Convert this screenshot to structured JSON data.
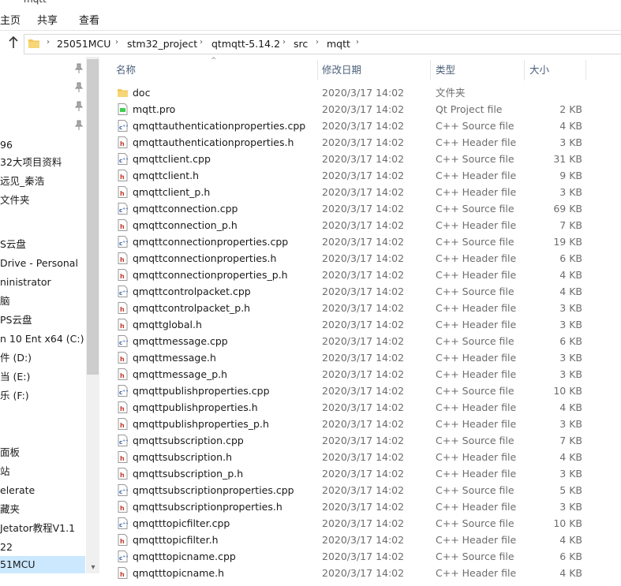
{
  "window": {
    "title": "mqtt"
  },
  "ribbon": {
    "tabs": [
      "主页",
      "共享",
      "查看"
    ]
  },
  "address": {
    "crumbs": [
      "25051MCU",
      "stm32_project",
      "qtmqtt-5.14.2",
      "src",
      "mqtt"
    ]
  },
  "nav": {
    "items": [
      "",
      "",
      "",
      "",
      "96",
      "32大项目资料",
      "远见_秦浩",
      "文件夹",
      "",
      "S云盘",
      "Drive - Personal",
      "ninistrator",
      "脑",
      "PS云盘",
      "n 10 Ent x64 (C:)",
      "件 (D:)",
      "当 (E:)",
      "乐 (F:)",
      "",
      "",
      "面板",
      "站",
      "elerate",
      "藏夹",
      "Jetator教程V1.1",
      "22",
      "51MCU"
    ]
  },
  "columns": {
    "name": "名称",
    "date": "修改日期",
    "type": "类型",
    "size": "大小"
  },
  "files": [
    {
      "name": "doc",
      "date": "2020/3/17 14:02",
      "type": "文件夹",
      "size": "",
      "icon": "folder-icon"
    },
    {
      "name": "mqtt.pro",
      "date": "2020/3/17 14:02",
      "type": "Qt Project file",
      "size": "2 KB",
      "icon": "pro-file-icon"
    },
    {
      "name": "qmqttauthenticationproperties.cpp",
      "date": "2020/3/17 14:02",
      "type": "C++ Source file",
      "size": "4 KB",
      "icon": "cpp-file-icon"
    },
    {
      "name": "qmqttauthenticationproperties.h",
      "date": "2020/3/17 14:02",
      "type": "C++ Header file",
      "size": "3 KB",
      "icon": "h-file-icon"
    },
    {
      "name": "qmqttclient.cpp",
      "date": "2020/3/17 14:02",
      "type": "C++ Source file",
      "size": "31 KB",
      "icon": "cpp-file-icon"
    },
    {
      "name": "qmqttclient.h",
      "date": "2020/3/17 14:02",
      "type": "C++ Header file",
      "size": "9 KB",
      "icon": "h-file-icon"
    },
    {
      "name": "qmqttclient_p.h",
      "date": "2020/3/17 14:02",
      "type": "C++ Header file",
      "size": "3 KB",
      "icon": "h-file-icon"
    },
    {
      "name": "qmqttconnection.cpp",
      "date": "2020/3/17 14:02",
      "type": "C++ Source file",
      "size": "69 KB",
      "icon": "cpp-file-icon"
    },
    {
      "name": "qmqttconnection_p.h",
      "date": "2020/3/17 14:02",
      "type": "C++ Header file",
      "size": "7 KB",
      "icon": "h-file-icon"
    },
    {
      "name": "qmqttconnectionproperties.cpp",
      "date": "2020/3/17 14:02",
      "type": "C++ Source file",
      "size": "19 KB",
      "icon": "cpp-file-icon"
    },
    {
      "name": "qmqttconnectionproperties.h",
      "date": "2020/3/17 14:02",
      "type": "C++ Header file",
      "size": "6 KB",
      "icon": "h-file-icon"
    },
    {
      "name": "qmqttconnectionproperties_p.h",
      "date": "2020/3/17 14:02",
      "type": "C++ Header file",
      "size": "4 KB",
      "icon": "h-file-icon"
    },
    {
      "name": "qmqttcontrolpacket.cpp",
      "date": "2020/3/17 14:02",
      "type": "C++ Source file",
      "size": "4 KB",
      "icon": "cpp-file-icon"
    },
    {
      "name": "qmqttcontrolpacket_p.h",
      "date": "2020/3/17 14:02",
      "type": "C++ Header file",
      "size": "3 KB",
      "icon": "h-file-icon"
    },
    {
      "name": "qmqttglobal.h",
      "date": "2020/3/17 14:02",
      "type": "C++ Header file",
      "size": "3 KB",
      "icon": "h-file-icon"
    },
    {
      "name": "qmqttmessage.cpp",
      "date": "2020/3/17 14:02",
      "type": "C++ Source file",
      "size": "6 KB",
      "icon": "cpp-file-icon"
    },
    {
      "name": "qmqttmessage.h",
      "date": "2020/3/17 14:02",
      "type": "C++ Header file",
      "size": "3 KB",
      "icon": "h-file-icon"
    },
    {
      "name": "qmqttmessage_p.h",
      "date": "2020/3/17 14:02",
      "type": "C++ Header file",
      "size": "3 KB",
      "icon": "h-file-icon"
    },
    {
      "name": "qmqttpublishproperties.cpp",
      "date": "2020/3/17 14:02",
      "type": "C++ Source file",
      "size": "10 KB",
      "icon": "cpp-file-icon"
    },
    {
      "name": "qmqttpublishproperties.h",
      "date": "2020/3/17 14:02",
      "type": "C++ Header file",
      "size": "4 KB",
      "icon": "h-file-icon"
    },
    {
      "name": "qmqttpublishproperties_p.h",
      "date": "2020/3/17 14:02",
      "type": "C++ Header file",
      "size": "3 KB",
      "icon": "h-file-icon"
    },
    {
      "name": "qmqttsubscription.cpp",
      "date": "2020/3/17 14:02",
      "type": "C++ Source file",
      "size": "7 KB",
      "icon": "cpp-file-icon"
    },
    {
      "name": "qmqttsubscription.h",
      "date": "2020/3/17 14:02",
      "type": "C++ Header file",
      "size": "4 KB",
      "icon": "h-file-icon"
    },
    {
      "name": "qmqttsubscription_p.h",
      "date": "2020/3/17 14:02",
      "type": "C++ Header file",
      "size": "3 KB",
      "icon": "h-file-icon"
    },
    {
      "name": "qmqttsubscriptionproperties.cpp",
      "date": "2020/3/17 14:02",
      "type": "C++ Source file",
      "size": "5 KB",
      "icon": "cpp-file-icon"
    },
    {
      "name": "qmqttsubscriptionproperties.h",
      "date": "2020/3/17 14:02",
      "type": "C++ Header file",
      "size": "3 KB",
      "icon": "h-file-icon"
    },
    {
      "name": "qmqtttopicfilter.cpp",
      "date": "2020/3/17 14:02",
      "type": "C++ Source file",
      "size": "10 KB",
      "icon": "cpp-file-icon"
    },
    {
      "name": "qmqtttopicfilter.h",
      "date": "2020/3/17 14:02",
      "type": "C++ Header file",
      "size": "4 KB",
      "icon": "h-file-icon"
    },
    {
      "name": "qmqtttopicname.cpp",
      "date": "2020/3/17 14:02",
      "type": "C++ Source file",
      "size": "6 KB",
      "icon": "cpp-file-icon"
    },
    {
      "name": "qmqtttopicname.h",
      "date": "2020/3/17 14:02",
      "type": "C++ Header file",
      "size": "4 KB",
      "icon": "h-file-icon"
    }
  ],
  "colors": {
    "selection": "#cce8ff",
    "header_text": "#4c607a",
    "h_icon": "#c0392b",
    "cpp_icon": "#2f5ea8",
    "folder": "#f3c75a"
  }
}
